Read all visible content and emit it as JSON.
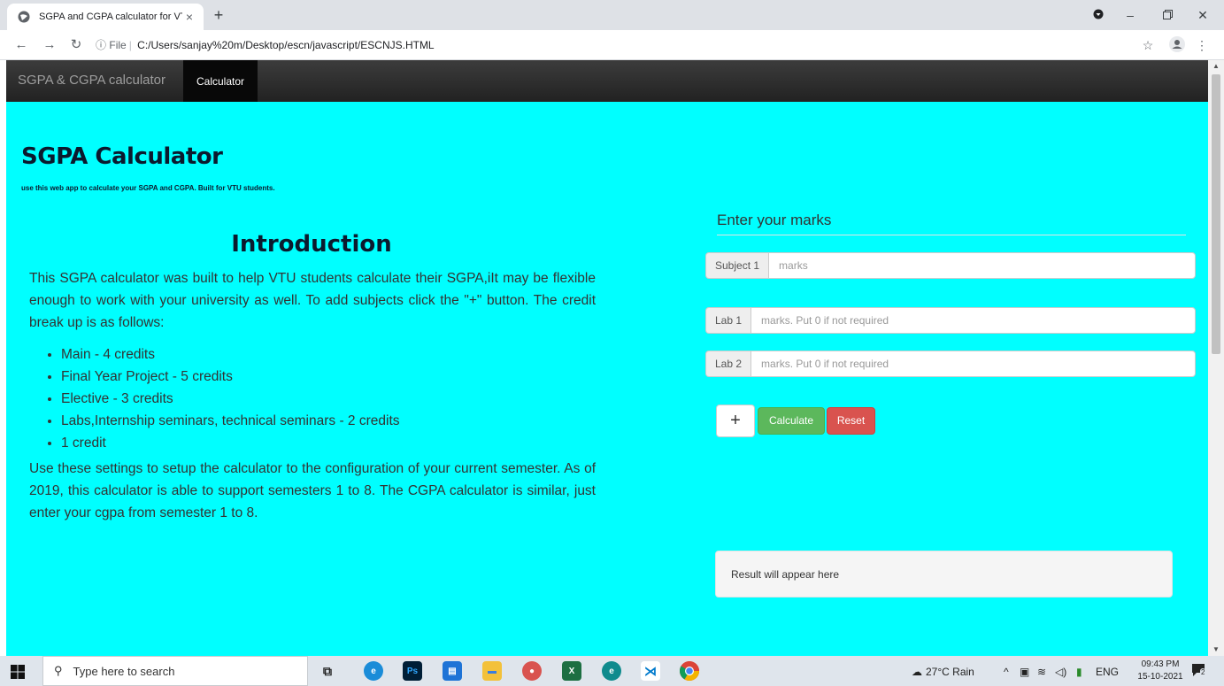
{
  "browser": {
    "tab_title": "SGPA and CGPA calculator for VT",
    "tab_close": "×",
    "new_tab": "+",
    "url_scheme": "File",
    "url_path": "C:/Users/sanjay%20m/Desktop/escn/javascript/ESCNJS.HTML"
  },
  "navbar": {
    "brand": "SGPA & CGPA calculator",
    "active_link": "Calculator"
  },
  "header": {
    "title": "SGPA Calculator",
    "subtitle": "use this web app to calculate your SGPA and CGPA. Built for VTU students."
  },
  "intro": {
    "title": "Introduction",
    "p1": "This SGPA calculator was built to help VTU students calculate their SGPA,iIt may be flexible enough to work with your university as well. To add subjects click the \"+\" button. The credit break up is as follows:",
    "credits": [
      "Main - 4 credits",
      "Final Year Project - 5 credits",
      "Elective - 3 credits",
      "Labs,Internship seminars, technical seminars - 2 credits",
      "1 credit"
    ],
    "p2": "Use these settings to setup the calculator to the configuration of your current semester. As of 2019, this calculator is able to support semesters 1 to 8. The CGPA calculator is similar, just enter your cgpa from semester 1 to 8."
  },
  "form": {
    "heading": "Enter your marks",
    "rows": [
      {
        "label": "Subject 1",
        "placeholder": "marks"
      },
      {
        "label": "Lab 1",
        "placeholder": "marks. Put 0 if not required"
      },
      {
        "label": "Lab 2",
        "placeholder": "marks. Put 0 if not required"
      }
    ],
    "add_label": "+",
    "calculate_label": "Calculate",
    "reset_label": "Reset",
    "result_text": "Result will appear here",
    "colors": {
      "calculate": "#5cb85c",
      "reset": "#d9534f",
      "page_bg": "#00ffff"
    }
  },
  "taskbar": {
    "search_placeholder": "Type here to search",
    "weather": "27°C  Rain",
    "language": "ENG",
    "time": "09:43 PM",
    "date": "15-10-2021",
    "notifications": "2",
    "apps": [
      "task-view",
      "edge",
      "photoshop",
      "calendar",
      "file-explorer",
      "chrome-dev",
      "excel",
      "edge-beta",
      "vscode",
      "chrome"
    ]
  }
}
